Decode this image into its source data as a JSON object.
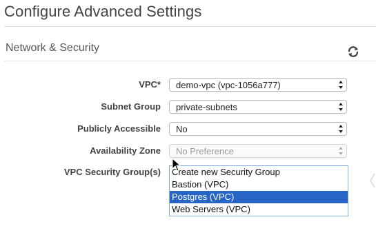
{
  "header": {
    "title": "Configure Advanced Settings"
  },
  "section": {
    "title": "Network & Security",
    "refresh_icon": "refresh-icon"
  },
  "form": {
    "vpc": {
      "label": "VPC*",
      "value": "demo-vpc (vpc-1056a777)"
    },
    "subnet_group": {
      "label": "Subnet Group",
      "value": "private-subnets"
    },
    "publicly_accessible": {
      "label": "Publicly Accessible",
      "value": "No"
    },
    "availability_zone": {
      "label": "Availability Zone",
      "value": "No Preference",
      "disabled": true
    },
    "security_groups": {
      "label": "VPC Security Group(s)",
      "options": [
        {
          "label": "Create new Security Group",
          "selected": false
        },
        {
          "label": "Bastion (VPC)",
          "selected": false
        },
        {
          "label": "Postgres (VPC)",
          "selected": true
        },
        {
          "label": "Web Servers (VPC)",
          "selected": false
        }
      ]
    }
  },
  "colors": {
    "selection": "#2764c6",
    "listbox_border": "#7faedc"
  }
}
